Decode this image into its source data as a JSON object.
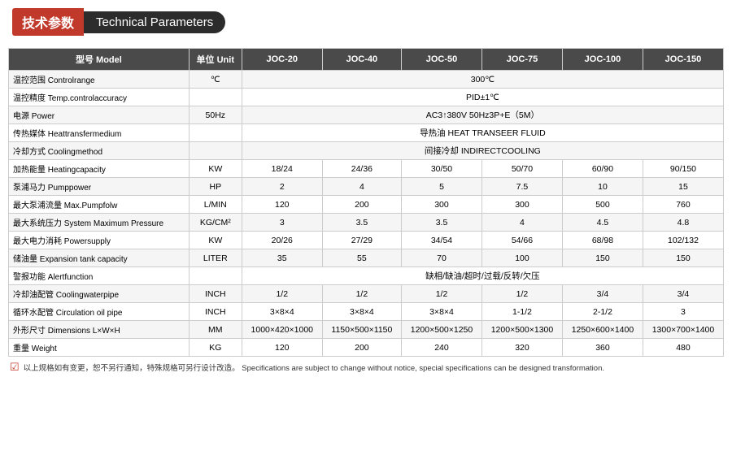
{
  "header": {
    "title_cn": "技术参数",
    "title_en": "Technical Parameters"
  },
  "table": {
    "columns": [
      "型号 Model",
      "单位 Unit",
      "JOC-20",
      "JOC-40",
      "JOC-50",
      "JOC-75",
      "JOC-100",
      "JOC-150"
    ],
    "rows": [
      {
        "label": "温控范围 Controlrange",
        "unit": "℃",
        "values": [
          "300℃",
          "",
          "",
          "",
          "",
          ""
        ],
        "span": true
      },
      {
        "label": "温控精度 Temp.controlaccuracy",
        "unit": "",
        "values": [
          "PID±1℃",
          "",
          "",
          "",
          "",
          ""
        ],
        "span": true
      },
      {
        "label": "电源 Power",
        "unit": "50Hz",
        "values": [
          "AC3↑380V 50Hz3P+E（5M）",
          "",
          "",
          "",
          "",
          ""
        ],
        "span": true
      },
      {
        "label": "传热媒体 Heattransfermedium",
        "unit": "",
        "values": [
          "导热油 HEAT TRANSEER FLUID",
          "",
          "",
          "",
          "",
          ""
        ],
        "span": true
      },
      {
        "label": "冷却方式 Coolingmethod",
        "unit": "",
        "values": [
          "间接冷却 INDIRECTCOOLING",
          "",
          "",
          "",
          "",
          ""
        ],
        "span": true
      },
      {
        "label": "加热能量 Heatingcapacity",
        "unit": "KW",
        "values": [
          "18/24",
          "24/36",
          "30/50",
          "50/70",
          "60/90",
          "90/150"
        ],
        "span": false
      },
      {
        "label": "泵浦马力 Pumppower",
        "unit": "HP",
        "values": [
          "2",
          "4",
          "5",
          "7.5",
          "10",
          "15"
        ],
        "span": false
      },
      {
        "label": "最大泵浦流量 Max.Pumpfolw",
        "unit": "L/MIN",
        "values": [
          "120",
          "200",
          "300",
          "300",
          "500",
          "760"
        ],
        "span": false
      },
      {
        "label": "最大系统压力 System Maximum Pressure",
        "unit": "KG/CM²",
        "values": [
          "3",
          "3.5",
          "3.5",
          "4",
          "4.5",
          "4.8"
        ],
        "span": false
      },
      {
        "label": "最大电力消耗 Powersupply",
        "unit": "KW",
        "values": [
          "20/26",
          "27/29",
          "34/54",
          "54/66",
          "68/98",
          "102/132"
        ],
        "span": false
      },
      {
        "label": "储油量 Expansion tank capacity",
        "unit": "LITER",
        "values": [
          "35",
          "55",
          "70",
          "100",
          "150",
          "150"
        ],
        "span": false
      },
      {
        "label": "警报功能 Alertfunction",
        "unit": "",
        "values": [
          "缺相/缺油/超时/过载/反转/欠压",
          "",
          "",
          "",
          "",
          ""
        ],
        "span": true
      },
      {
        "label": "冷却油配管 Coolingwaterpipe",
        "unit": "INCH",
        "values": [
          "1/2",
          "1/2",
          "1/2",
          "1/2",
          "3/4",
          "3/4"
        ],
        "span": false
      },
      {
        "label": "循环水配管 Circulation oil pipe",
        "unit": "INCH",
        "values": [
          "3×8×4",
          "3×8×4",
          "3×8×4",
          "1-1/2",
          "2-1/2",
          "3"
        ],
        "span": false
      },
      {
        "label": "外形尺寸 Dimensions L×W×H",
        "unit": "MM",
        "values": [
          "1000×420×1000",
          "1150×500×1150",
          "1200×500×1250",
          "1200×500×1300",
          "1250×600×1400",
          "1300×700×1400"
        ],
        "span": false
      },
      {
        "label": "重量 Weight",
        "unit": "KG",
        "values": [
          "120",
          "200",
          "240",
          "320",
          "360",
          "480"
        ],
        "span": false
      }
    ]
  },
  "footer": {
    "check_icon": "☑",
    "note": "以上规格如有变更，恕不另行通知，特殊规格可另行设计改造。  Specifications are subject to change without notice, special specifications can be designed transformation."
  }
}
